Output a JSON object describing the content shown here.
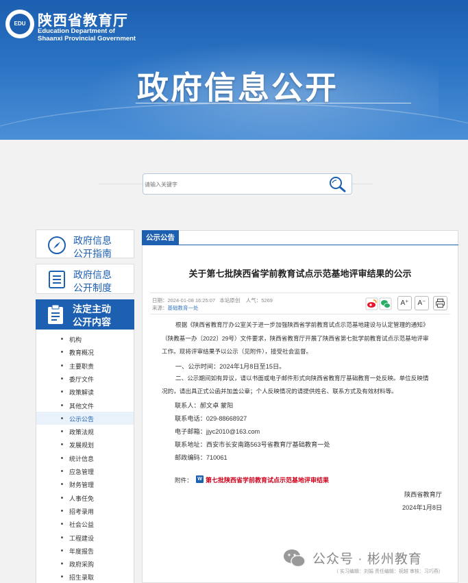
{
  "header": {
    "org_cn": "陕西省教育厅",
    "org_en_line1": "Education Department of",
    "org_en_line2": "Shaanxi Provincial Government",
    "page_title": "政府信息公开",
    "logo_text": "EDU"
  },
  "search": {
    "placeholder": "请输入关键字"
  },
  "sidebar": {
    "guide": {
      "line1": "政府信息",
      "line2": "公开指南"
    },
    "system": {
      "line1": "政府信息",
      "line2": "公开制度"
    },
    "active": {
      "line1": "法定主动",
      "line2": "公开内容"
    },
    "items": [
      {
        "label": "机构",
        "selected": false
      },
      {
        "label": "教育概况",
        "selected": false
      },
      {
        "label": "主要职责",
        "selected": false
      },
      {
        "label": "委厅文件",
        "selected": false
      },
      {
        "label": "政策解读",
        "selected": false
      },
      {
        "label": "其他文件",
        "selected": false
      },
      {
        "label": "公示公告",
        "selected": true
      },
      {
        "label": "政策法规",
        "selected": false
      },
      {
        "label": "发展规划",
        "selected": false
      },
      {
        "label": "统计信息",
        "selected": false
      },
      {
        "label": "应急管理",
        "selected": false
      },
      {
        "label": "财务管理",
        "selected": false
      },
      {
        "label": "人事任免",
        "selected": false
      },
      {
        "label": "招考录用",
        "selected": false
      },
      {
        "label": "社会公益",
        "selected": false
      },
      {
        "label": "工程建设",
        "selected": false
      },
      {
        "label": "年度报告",
        "selected": false
      },
      {
        "label": "政府采购",
        "selected": false
      },
      {
        "label": "招生录取",
        "selected": false
      }
    ]
  },
  "main": {
    "tab": "公示公告",
    "title": "关于第七批陕西省学前教育试点示范基地评审结果的公示",
    "meta": {
      "date": "日期：2024-01-08 16:25:07",
      "origin": "本站原创",
      "views": "人气：5269",
      "source_label": "来源：",
      "source": "基础教育一处"
    },
    "tools": {
      "font_up": "A⁺",
      "font_down": "A⁻",
      "print": "print"
    },
    "body": {
      "p1_l1": "根据《陕西省教育厅办公室关于进一步加强陕西省学前教育试点示范基地建设与认定管理的通知》",
      "p1_l2": "（陕教基一办〔2022〕29号）文件要求，陕西省教育厅开展了陕西省第七批学前教育试点示范基地评审",
      "p1_l3": "工作。现将评审结果予以公示（见附件），接受社会监督。",
      "p2": "一、公示时间：2024年1月8日至15日。",
      "p3_l1": "二、公示期间如有异议，请以书面或电子邮件形式向陕西省教育厅基础教育一处反映。单位反映情",
      "p3_l2": "况的，请出具正式公函并加盖公章；个人反映情况的请提供姓名、联系方式及有效材料等。",
      "contact": "联系人：郝文卓  蒙阳",
      "phone": "联系电话：029-88668927",
      "email": "电子邮箱：jjyc2010@163.com",
      "address": "联系地址：西安市长安南路563号省教育厅基础教育一处",
      "postcode": "邮政编码：710061",
      "attachment_label": "附件：",
      "attachment_link": "第七批陕西省学前教育试点示范基地评审结果",
      "signature": "陕西省教育厅",
      "sign_date": "2024年1月8日"
    }
  },
  "watermark": {
    "text": "公众号 · 彬州教育",
    "editor": "（ 实习编辑：刘娟  责任编辑：祝越  审核：习巧燕）"
  },
  "colors": {
    "brand": "#1d5fb0",
    "attachment": "#d0021b",
    "wechat": "#2aae67"
  }
}
